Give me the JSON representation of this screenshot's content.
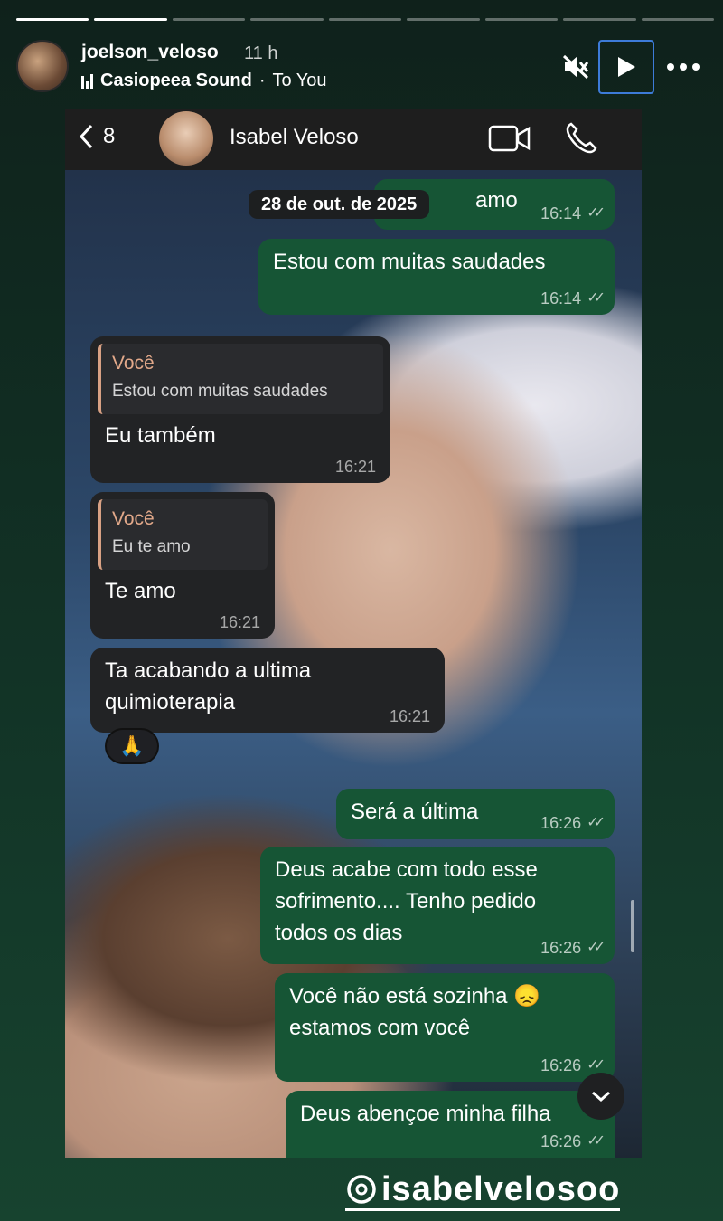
{
  "story": {
    "progress": {
      "total": 9,
      "done": 2
    },
    "username": "joelson_veloso",
    "time_ago": "11 h",
    "music": {
      "title": "Casiopeea Sound",
      "artist": "To You"
    },
    "icons": {
      "mute": "speaker-mute-icon",
      "play": "play-icon",
      "more": "more-icon",
      "music": "music-bars-icon"
    },
    "mention": "isabelvelosoo",
    "accent_color": "#3d7bd8"
  },
  "chat": {
    "back_count": "8",
    "contact_name": "Isabel Veloso",
    "date": "28 de out. de 2025",
    "reaction": "🙏",
    "messages": [
      {
        "id": "m0",
        "dir": "out",
        "text": "amo",
        "time": "16:14",
        "read": true
      },
      {
        "id": "m1",
        "dir": "out",
        "text": "Estou com muitas saudades",
        "time": "16:14",
        "read": true
      },
      {
        "id": "m2",
        "dir": "in",
        "quote_author": "Você",
        "quote_text": "Estou com muitas saudades",
        "text": "Eu também",
        "time": "16:21"
      },
      {
        "id": "m3",
        "dir": "in",
        "quote_author": "Você",
        "quote_text": "Eu te amo",
        "text": "Te amo",
        "time": "16:21"
      },
      {
        "id": "m4",
        "dir": "in",
        "text": "Ta acabando a ultima\nquimioterapia",
        "time": "16:21"
      },
      {
        "id": "m5",
        "dir": "out",
        "text": "Será a última",
        "time": "16:26",
        "read": true
      },
      {
        "id": "m6",
        "dir": "out",
        "text": "Deus acabe com todo esse\nsofrimento.... Tenho pedido\ntodos os dias",
        "time": "16:26",
        "read": true
      },
      {
        "id": "m7",
        "dir": "out",
        "text": "Você não está sozinha 😞\nestamos com você",
        "time": "16:26",
        "read": true
      },
      {
        "id": "m8",
        "dir": "out",
        "text": "Deus abençoe minha filha",
        "time": "16:26",
        "read": true
      }
    ],
    "colors": {
      "outgoing": "#165535",
      "incoming": "#222325",
      "quote_author": "#e3a98a"
    }
  }
}
